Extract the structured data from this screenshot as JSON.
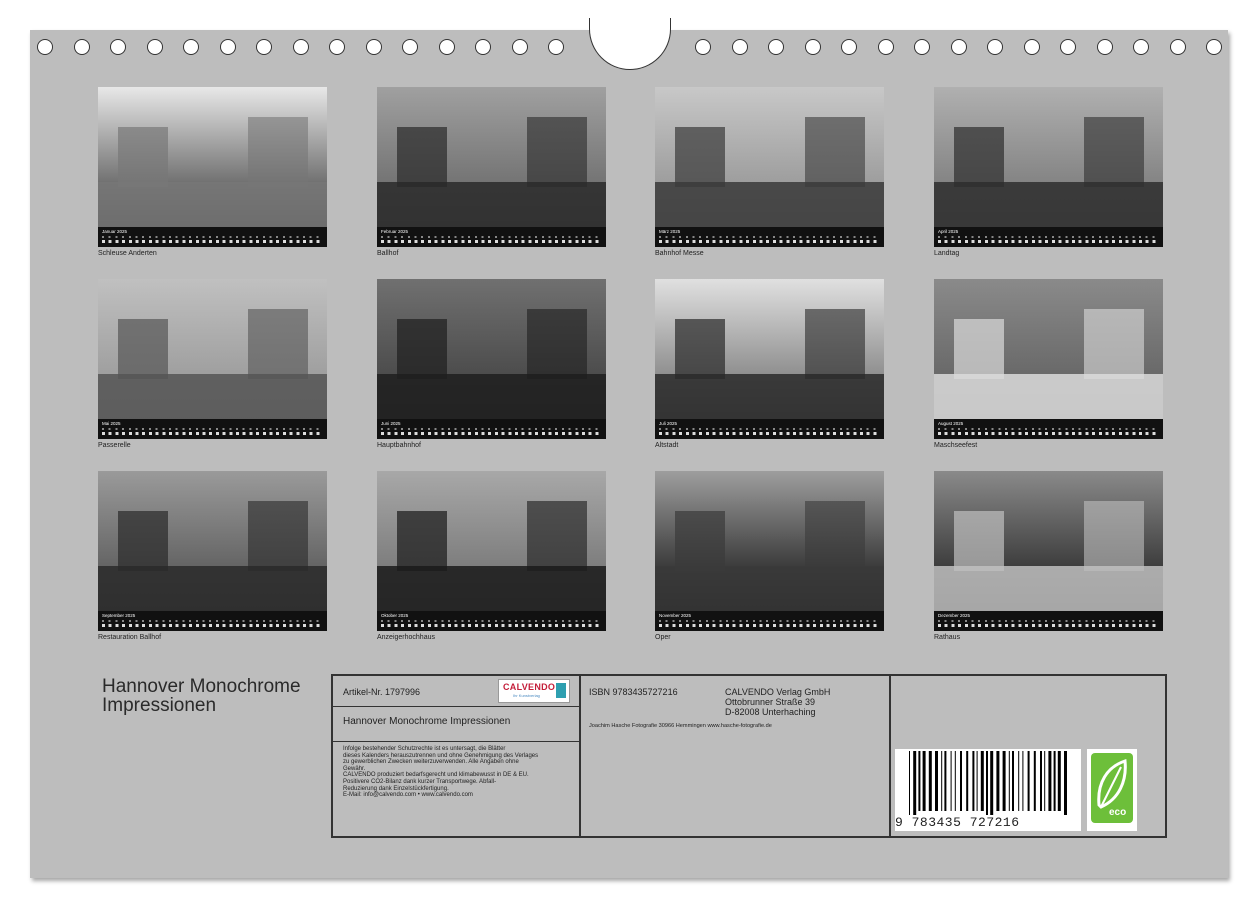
{
  "months": [
    {
      "label": "Januar 2025",
      "caption": "Schleuse Anderten"
    },
    {
      "label": "Februar 2025",
      "caption": "Ballhof"
    },
    {
      "label": "März 2025",
      "caption": "Bahnhof Messe"
    },
    {
      "label": "April 2025",
      "caption": "Landtag"
    },
    {
      "label": "Mai 2025",
      "caption": "Passerelle"
    },
    {
      "label": "Juni 2025",
      "caption": "Hauptbahnhof"
    },
    {
      "label": "Juli 2025",
      "caption": "Altstadt"
    },
    {
      "label": "August 2025",
      "caption": "Maschseefest"
    },
    {
      "label": "September 2025",
      "caption": "Restauration Ballhof"
    },
    {
      "label": "Oktober 2025",
      "caption": "Anzeigerhochhaus"
    },
    {
      "label": "November 2025",
      "caption": "Oper"
    },
    {
      "label": "Dezember 2025",
      "caption": "Rathaus"
    }
  ],
  "title": "Hannover Monochrome Impressionen",
  "info": {
    "article": "Artikel-Nr. 1797996",
    "logo_text": "CALVENDO",
    "logo_sub": "Ihr Kunstverlag",
    "subtitle": "Hannover Monochrome Impressionen",
    "legal_lines": [
      "Infolge bestehender Schutzrechte ist es untersagt, die Blätter",
      "dieses Kalenders herauszutrennen und ohne Genehmigung des Verlages",
      "zu gewerblichen Zwecken weiterzuverwenden. Alle Angaben ohne",
      "Gewähr.",
      "CALVENDO produziert bedarfsgerecht und klimabewusst in DE & EU.",
      "Positivere CO2-Bilanz dank kurzer Transportwege. Abfall-",
      "Reduzierung dank Einzelstückfertigung.",
      "E-Mail: info@calvendo.com • www.calvendo.com"
    ],
    "isbn": "ISBN 9783435727216",
    "publisher_lines": [
      "CALVENDO Verlag GmbH",
      "Ottobrunner Straße 39",
      "D-82008 Unterhaching"
    ],
    "photographer": "Joachim Hasche Fotografie 30966 Hemmingen www.hasche-fotografie.de",
    "barcode_number": "9 783435 727216",
    "eco_label": "eco"
  }
}
